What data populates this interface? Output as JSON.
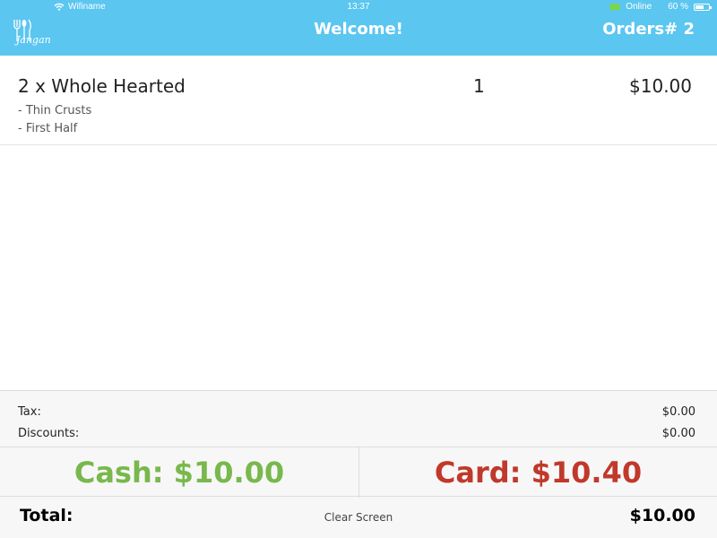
{
  "status_bar": {
    "network": "Wifiname",
    "time": "13:37",
    "connection": "Online",
    "battery": "60 %"
  },
  "header": {
    "logo_text": "Jangan",
    "title": "Welcome!",
    "orders": "Orders# 2",
    "background": "#5bc6f0"
  },
  "order": {
    "items": [
      {
        "name": "2 x Whole Hearted",
        "quantity": "1",
        "price": "$10.00",
        "modifiers": [
          "- Thin Crusts",
          "- First Half"
        ]
      }
    ]
  },
  "summary": {
    "tax_label": "Tax:",
    "tax_value": "$0.00",
    "discounts_label": "Discounts:",
    "discounts_value": "$0.00",
    "cash_label": "Cash: $10.00",
    "card_label": "Card: $10.40",
    "total_label": "Total:",
    "clear_label": "Clear Screen",
    "total_value": "$10.00"
  },
  "colors": {
    "cash": "#78b84c",
    "card": "#c0392b"
  }
}
